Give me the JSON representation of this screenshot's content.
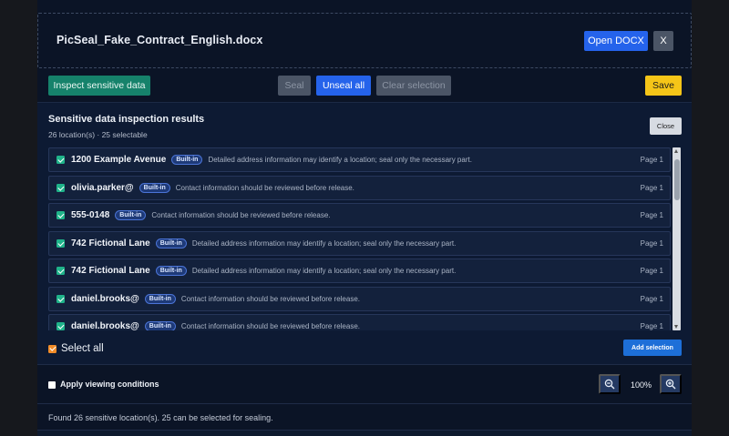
{
  "header": {
    "filename": "PicSeal_Fake_Contract_English.docx",
    "open_label": "Open DOCX",
    "close_label": "X"
  },
  "toolbar": {
    "inspect_label": "Inspect sensitive data",
    "seal_label": "Seal",
    "unseal_label": "Unseal all",
    "clear_label": "Clear selection",
    "save_label": "Save"
  },
  "results": {
    "title": "Sensitive data inspection results",
    "subtitle": "26 location(s) · 25 selectable",
    "close_label": "Close",
    "items": [
      {
        "name": "1200 Example Avenue",
        "badge": "Built-in",
        "desc": "Detailed address information may identify a location; seal only the necessary part.",
        "page": "Page 1"
      },
      {
        "name": "olivia.parker@",
        "badge": "Built-in",
        "desc": "Contact information should be reviewed before release.",
        "page": "Page 1"
      },
      {
        "name": "555-0148",
        "badge": "Built-in",
        "desc": "Contact information should be reviewed before release.",
        "page": "Page 1"
      },
      {
        "name": "742 Fictional Lane",
        "badge": "Built-in",
        "desc": "Detailed address information may identify a location; seal only the necessary part.",
        "page": "Page 1"
      },
      {
        "name": "742 Fictional Lane",
        "badge": "Built-in",
        "desc": "Detailed address information may identify a location; seal only the necessary part.",
        "page": "Page 1"
      },
      {
        "name": "daniel.brooks@",
        "badge": "Built-in",
        "desc": "Contact information should be reviewed before release.",
        "page": "Page 1"
      },
      {
        "name": "daniel.brooks@",
        "badge": "Built-in",
        "desc": "Contact information should be reviewed before release.",
        "page": "Page 1"
      }
    ],
    "select_all_label": "Select all",
    "add_selection_label": "Add selection"
  },
  "view": {
    "apply_label": "Apply viewing conditions",
    "zoom_value": "100%"
  },
  "status": "Found 26 sensitive location(s). 25 can be selected for sealing.",
  "colors": {
    "accent_blue": "#2563eb",
    "accent_green": "#16826b",
    "save_yellow": "#f5c518",
    "select_all_orange": "#f28c28"
  }
}
